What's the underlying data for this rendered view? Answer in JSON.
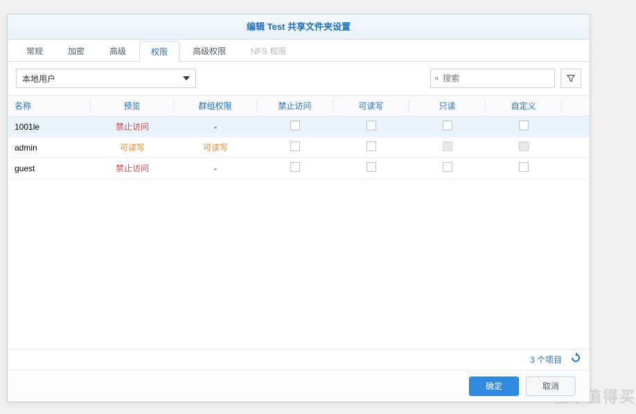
{
  "dialog": {
    "title": "编辑 Test 共享文件夹设置"
  },
  "tabs": [
    {
      "label": "常规",
      "active": false,
      "disabled": false
    },
    {
      "label": "加密",
      "active": false,
      "disabled": false
    },
    {
      "label": "高级",
      "active": false,
      "disabled": false
    },
    {
      "label": "权限",
      "active": true,
      "disabled": false
    },
    {
      "label": "高级权限",
      "active": false,
      "disabled": false
    },
    {
      "label": "NFS 权限",
      "active": false,
      "disabled": true
    }
  ],
  "toolbar": {
    "user_type_selected": "本地用户",
    "search_placeholder": "搜索"
  },
  "table": {
    "headers": {
      "name": "名称",
      "preview": "预览",
      "group_perm": "群组权限",
      "deny": "禁止访问",
      "rw": "可读写",
      "ro": "只读",
      "custom": "自定义"
    },
    "rows": [
      {
        "name": "1001le",
        "preview": "禁止访问",
        "preview_class": "preview-deny",
        "group_perm": "-",
        "selected": true,
        "deny_disabled": false,
        "rw_disabled": false,
        "ro_disabled": false,
        "custom_disabled": false
      },
      {
        "name": "admin",
        "preview": "可读写",
        "preview_class": "preview-rw",
        "group_perm": "可读写",
        "selected": false,
        "deny_disabled": false,
        "rw_disabled": false,
        "ro_disabled": true,
        "custom_disabled": true
      },
      {
        "name": "guest",
        "preview": "禁止访问",
        "preview_class": "preview-deny",
        "group_perm": "-",
        "selected": false,
        "deny_disabled": false,
        "rw_disabled": false,
        "ro_disabled": false,
        "custom_disabled": false
      }
    ]
  },
  "status": {
    "item_count": "3 个项目"
  },
  "footer": {
    "ok": "确定",
    "cancel": "取消"
  },
  "watermark": "值不值得买"
}
